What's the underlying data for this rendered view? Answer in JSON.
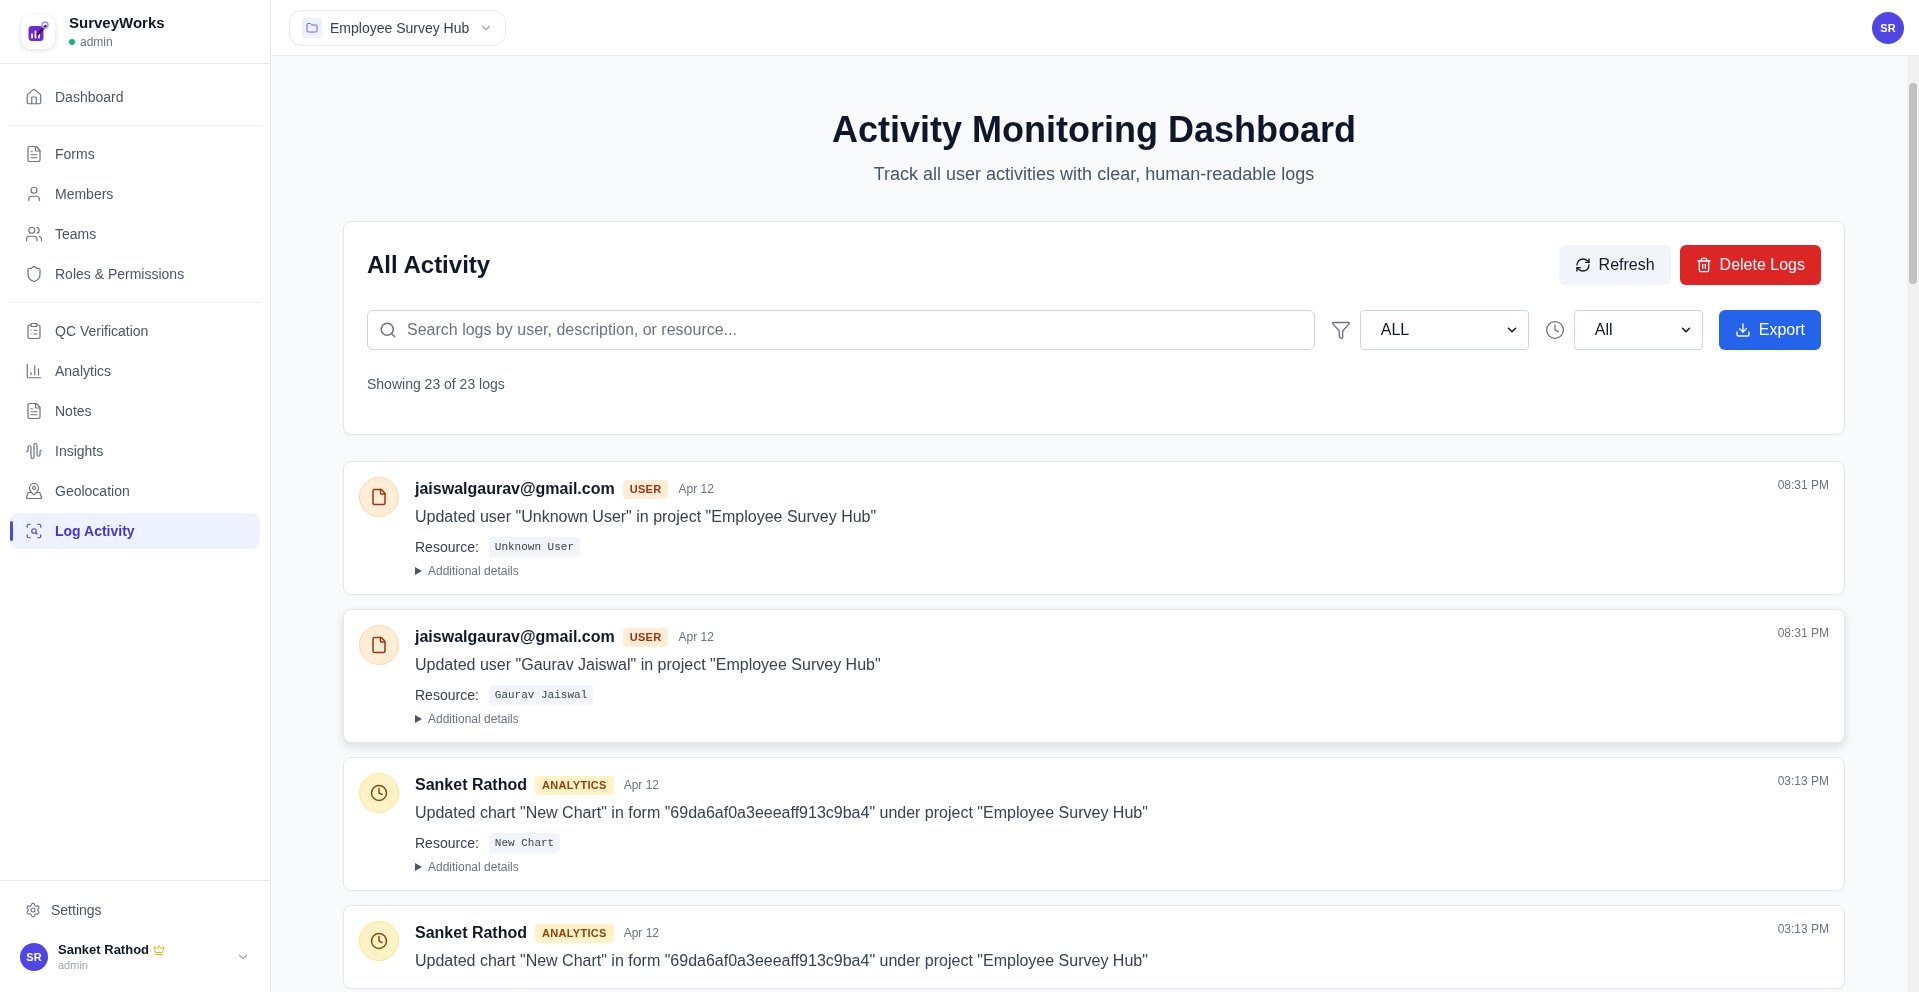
{
  "brand": {
    "name": "SurveyWorks",
    "role": "admin"
  },
  "sidebar": {
    "sections": [
      {
        "items": [
          {
            "label": "Dashboard",
            "selected": false
          }
        ]
      },
      {
        "items": [
          {
            "label": "Forms",
            "selected": false
          },
          {
            "label": "Members",
            "selected": false
          },
          {
            "label": "Teams",
            "selected": false
          },
          {
            "label": "Roles & Permissions",
            "selected": false
          }
        ]
      },
      {
        "items": [
          {
            "label": "QC Verification",
            "selected": false
          },
          {
            "label": "Analytics",
            "selected": false
          },
          {
            "label": "Notes",
            "selected": false
          },
          {
            "label": "Insights",
            "selected": false
          },
          {
            "label": "Geolocation",
            "selected": false
          },
          {
            "label": "Log Activity",
            "selected": true
          }
        ]
      }
    ],
    "settings": "Settings",
    "user": {
      "initials": "SR",
      "name": "Sanket Rathod",
      "role": "admin"
    }
  },
  "topbar": {
    "project": "Employee Survey Hub",
    "avatar": "SR"
  },
  "page": {
    "title": "Activity Monitoring Dashboard",
    "subtitle": "Track all user activities with clear, human-readable logs"
  },
  "activity": {
    "title": "All Activity",
    "refresh": "Refresh",
    "delete": "Delete Logs",
    "search": {
      "placeholder": "Search logs by user, description, or resource..."
    },
    "category_filter": "ALL",
    "time_filter": "All",
    "export": "Export",
    "count": "Showing 23 of 23 logs"
  },
  "logs": [
    {
      "kind": "user",
      "user": "jaiswalgaurav@gmail.com",
      "category": "USER",
      "date": "Apr 12",
      "time": "08:31 PM",
      "description": "Updated user \"Unknown User\" in project \"Employee Survey Hub\"",
      "resource_label": "Resource:",
      "resource": "Unknown User",
      "details": "Additional details",
      "expanded": false,
      "hovered": false
    },
    {
      "kind": "user",
      "user": "jaiswalgaurav@gmail.com",
      "category": "USER",
      "date": "Apr 12",
      "time": "08:31 PM",
      "description": "Updated user \"Gaurav Jaiswal\" in project \"Employee Survey Hub\"",
      "resource_label": "Resource:",
      "resource": "Gaurav Jaiswal",
      "details": "Additional details",
      "expanded": false,
      "hovered": true
    },
    {
      "kind": "analytics",
      "user": "Sanket Rathod",
      "category": "ANALYTICS",
      "date": "Apr 12",
      "time": "03:13 PM",
      "description": "Updated chart \"New Chart\" in form \"69da6af0a3eeeaff913c9ba4\" under project \"Employee Survey Hub\"",
      "resource_label": "Resource:",
      "resource": "New Chart",
      "details": "Additional details",
      "expanded": false,
      "hovered": false
    },
    {
      "kind": "analytics",
      "user": "Sanket Rathod",
      "category": "ANALYTICS",
      "date": "Apr 12",
      "time": "03:13 PM",
      "description": "Updated chart \"New Chart\" in form \"69da6af0a3eeeaff913c9ba4\" under project \"Employee Survey Hub\"",
      "hovered": false
    }
  ]
}
